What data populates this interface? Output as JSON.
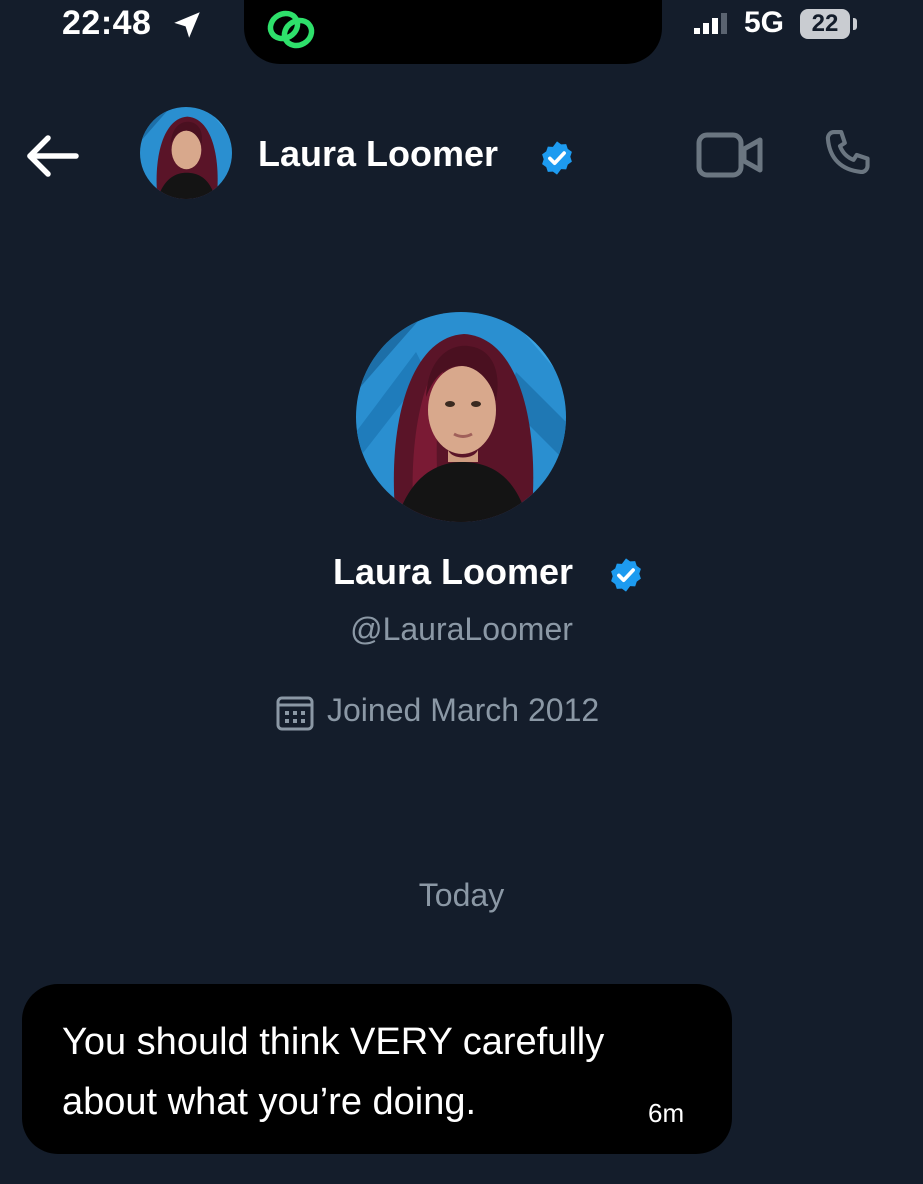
{
  "status_bar": {
    "time": "22:48",
    "network": "5G",
    "battery": "22"
  },
  "header": {
    "name": "Laura Loomer",
    "verified": true
  },
  "profile": {
    "name": "Laura Loomer",
    "handle": "@LauraLoomer",
    "joined": "Joined March 2012"
  },
  "conversation": {
    "day_separator": "Today",
    "messages": [
      {
        "text": "You should think VERY carefully about what you’re doing.",
        "time": "6m"
      }
    ]
  },
  "colors": {
    "background": "#141d2b",
    "verified_badge": "#1d9bf0",
    "secondary_text": "#8b98a5",
    "bubble": "#000000",
    "link_icon": "#2ee06b"
  },
  "icons": {
    "back": "arrow-left-icon",
    "verified": "verified-badge-icon",
    "video": "video-camera-icon",
    "call": "phone-icon",
    "calendar": "calendar-icon",
    "location": "location-arrow-icon",
    "link": "link-icon",
    "signal": "signal-icon"
  }
}
